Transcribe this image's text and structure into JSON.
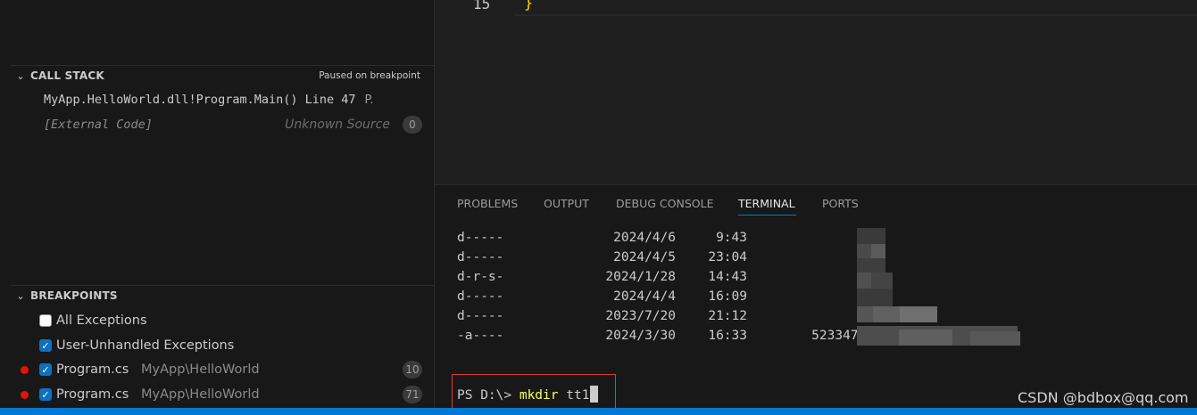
{
  "call_stack": {
    "title": "CALL STACK",
    "status": "Paused on breakpoint",
    "frames": [
      {
        "name": "MyApp.HelloWorld.dll!Program.Main() Line 47",
        "source": "P."
      },
      {
        "name": "[External Code]",
        "source": "Unknown Source",
        "count": "0"
      }
    ]
  },
  "breakpoints": {
    "title": "BREAKPOINTS",
    "items": [
      {
        "label": "All Exceptions",
        "checked": false
      },
      {
        "label": "User-Unhandled Exceptions",
        "checked": true
      },
      {
        "label": "Program.cs",
        "path": "MyApp\\HelloWorld",
        "count": "10",
        "checked": true
      },
      {
        "label": "Program.cs",
        "path": "MyApp\\HelloWorld",
        "count": "71",
        "checked": true
      }
    ]
  },
  "editor": {
    "line_number": "15",
    "code": "}"
  },
  "panel": {
    "tabs": [
      "PROBLEMS",
      "OUTPUT",
      "DEBUG CONSOLE",
      "TERMINAL",
      "PORTS"
    ],
    "active_tab": "TERMINAL",
    "terminal_rows": [
      {
        "mode": "d-----",
        "date": "2024/4/6",
        "time": "9:43",
        "size": ""
      },
      {
        "mode": "d-----",
        "date": "2024/4/5",
        "time": "23:04",
        "size": ""
      },
      {
        "mode": "d-r-s-",
        "date": "2024/1/28",
        "time": "14:43",
        "size": ""
      },
      {
        "mode": "d-----",
        "date": "2024/4/4",
        "time": "16:09",
        "size": ""
      },
      {
        "mode": "d-----",
        "date": "2023/7/20",
        "time": "21:12",
        "size": ""
      },
      {
        "mode": "-a----",
        "date": "2024/3/30",
        "time": "16:33",
        "size": "52334786"
      }
    ],
    "prompt": "PS D:\\>",
    "command": "mkdir",
    "argument": "tt1"
  },
  "watermark": "CSDN @bdbox@qq.com",
  "colors": {
    "accent": "#0078d4",
    "breakpoint": "#e51400",
    "prompt_highlight": "#d93a3a",
    "command": "#ffff55"
  }
}
